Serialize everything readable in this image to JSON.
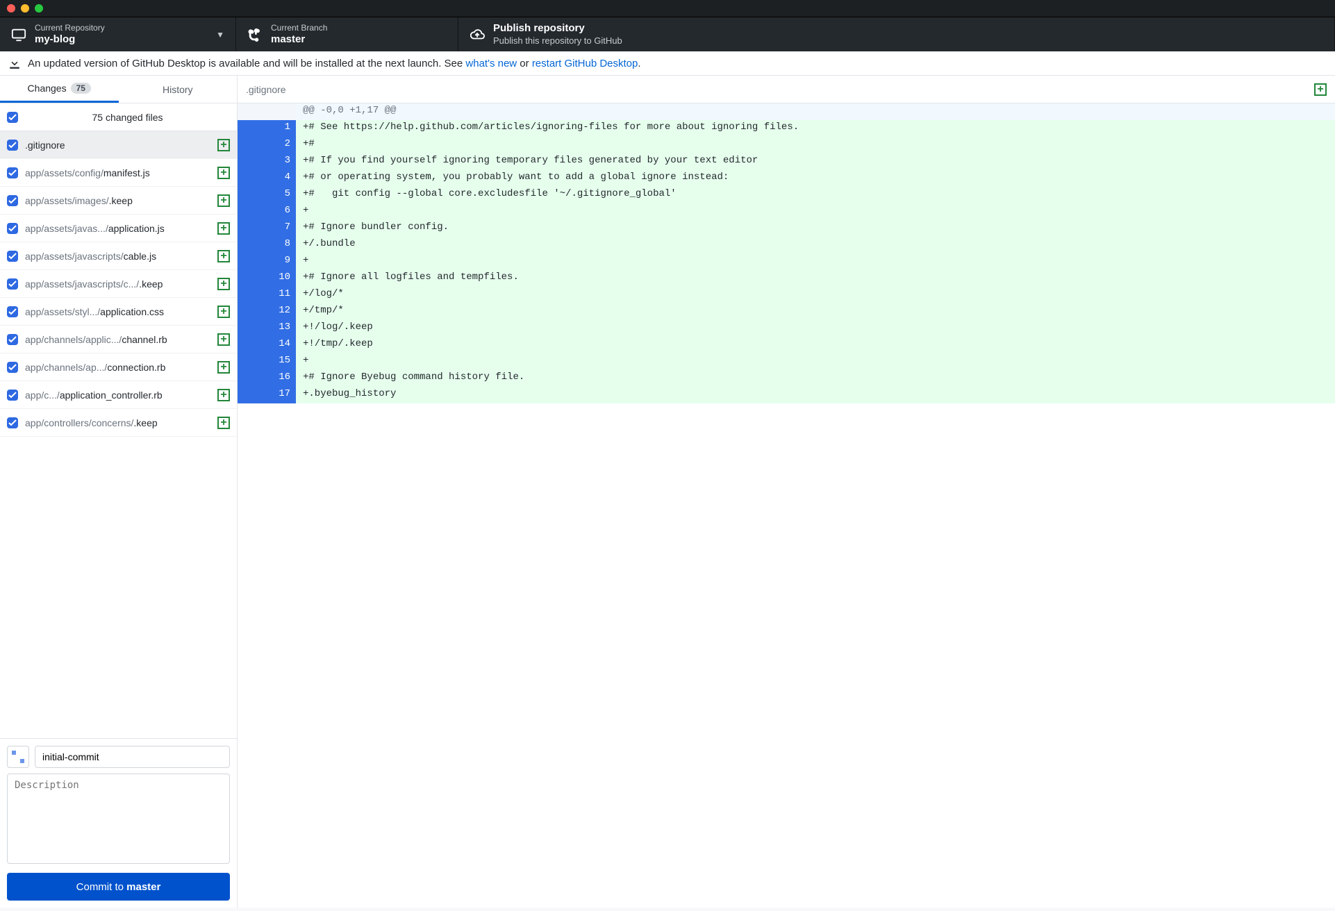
{
  "titlebar": {},
  "toolbar": {
    "repo": {
      "label": "Current Repository",
      "name": "my-blog"
    },
    "branch": {
      "label": "Current Branch",
      "name": "master"
    },
    "publish": {
      "title": "Publish repository",
      "subtitle": "Publish this repository to GitHub"
    }
  },
  "banner": {
    "text1": "An updated version of GitHub Desktop is available and will be installed at the next launch. See ",
    "link1": "what's new",
    "text2": " or ",
    "link2": "restart GitHub Desktop",
    "text3": "."
  },
  "tabs": {
    "changes": {
      "label": "Changes",
      "count": "75"
    },
    "history": {
      "label": "History"
    }
  },
  "file_header": "75 changed files",
  "files": [
    {
      "dim": "",
      "name": ".gitignore",
      "selected": true
    },
    {
      "dim": "app/assets/config/",
      "name": "manifest.js"
    },
    {
      "dim": "app/assets/images/",
      "name": ".keep"
    },
    {
      "dim": "app/assets/javas.../",
      "name": "application.js"
    },
    {
      "dim": "app/assets/javascripts/",
      "name": "cable.js"
    },
    {
      "dim": "app/assets/javascripts/c.../",
      "name": ".keep"
    },
    {
      "dim": "app/assets/styl.../",
      "name": "application.css"
    },
    {
      "dim": "app/channels/applic.../",
      "name": "channel.rb"
    },
    {
      "dim": "app/channels/ap.../",
      "name": "connection.rb"
    },
    {
      "dim": "app/c.../",
      "name": "application_controller.rb"
    },
    {
      "dim": "app/controllers/concerns/",
      "name": ".keep"
    }
  ],
  "commit": {
    "summary_value": "initial-commit",
    "description_placeholder": "Description",
    "button_prefix": "Commit to ",
    "button_branch": "master"
  },
  "diff": {
    "file": ".gitignore",
    "hunk": "@@ -0,0 +1,17 @@",
    "lines": [
      {
        "n": "1",
        "t": "+# See https://help.github.com/articles/ignoring-files for more about ignoring files."
      },
      {
        "n": "2",
        "t": "+#"
      },
      {
        "n": "3",
        "t": "+# If you find yourself ignoring temporary files generated by your text editor"
      },
      {
        "n": "4",
        "t": "+# or operating system, you probably want to add a global ignore instead:"
      },
      {
        "n": "5",
        "t": "+#   git config --global core.excludesfile '~/.gitignore_global'"
      },
      {
        "n": "6",
        "t": "+"
      },
      {
        "n": "7",
        "t": "+# Ignore bundler config."
      },
      {
        "n": "8",
        "t": "+/.bundle"
      },
      {
        "n": "9",
        "t": "+"
      },
      {
        "n": "10",
        "t": "+# Ignore all logfiles and tempfiles."
      },
      {
        "n": "11",
        "t": "+/log/*"
      },
      {
        "n": "12",
        "t": "+/tmp/*"
      },
      {
        "n": "13",
        "t": "+!/log/.keep"
      },
      {
        "n": "14",
        "t": "+!/tmp/.keep"
      },
      {
        "n": "15",
        "t": "+"
      },
      {
        "n": "16",
        "t": "+# Ignore Byebug command history file."
      },
      {
        "n": "17",
        "t": "+.byebug_history"
      }
    ]
  }
}
